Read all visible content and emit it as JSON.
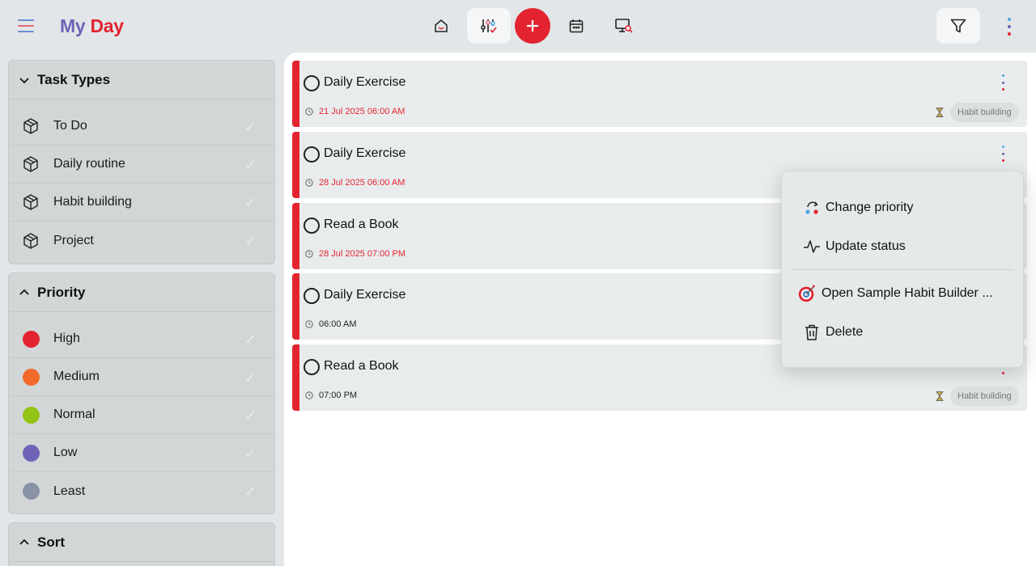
{
  "app": {
    "title_part1": "My",
    "title_part2": "Day"
  },
  "colors": {
    "accent": "#e32430",
    "brand_purple": "#6f63b8"
  },
  "toolbar": {
    "icons": [
      "home-icon",
      "sliders-check-icon",
      "add-icon",
      "calendar-icon",
      "monitor-search-icon",
      "filter-icon",
      "more-vertical-icon"
    ]
  },
  "sidebar": {
    "task_types": {
      "header": "Task Types",
      "items": [
        {
          "label": "To Do"
        },
        {
          "label": "Daily routine"
        },
        {
          "label": "Habit building"
        },
        {
          "label": "Project"
        }
      ]
    },
    "priority": {
      "header": "Priority",
      "items": [
        {
          "label": "High",
          "color": "#e32430"
        },
        {
          "label": "Medium",
          "color": "#f26b2b"
        },
        {
          "label": "Normal",
          "color": "#92c415"
        },
        {
          "label": "Low",
          "color": "#6f63b8"
        },
        {
          "label": "Least",
          "color": "#8a93a6"
        }
      ]
    },
    "sort": {
      "header": "Sort"
    }
  },
  "tasks": [
    {
      "title": "Daily Exercise",
      "date": "21 Jul 2025 06:00 AM",
      "date_overdue": true,
      "tag": "Habit building"
    },
    {
      "title": "Daily Exercise",
      "date": "28 Jul 2025 06:00 AM",
      "date_overdue": true,
      "tag": ""
    },
    {
      "title": "Read a Book",
      "date": "28 Jul 2025 07:00 PM",
      "date_overdue": true,
      "tag": ""
    },
    {
      "title": "Daily Exercise",
      "date": "06:00 AM",
      "date_overdue": false,
      "tag": ""
    },
    {
      "title": "Read a Book",
      "date": "07:00 PM",
      "date_overdue": false,
      "tag": "Habit building"
    }
  ],
  "context_menu": {
    "change_priority": "Change priority",
    "update_status": "Update status",
    "open_project": "Open Sample Habit Builder ...",
    "delete": "Delete"
  }
}
